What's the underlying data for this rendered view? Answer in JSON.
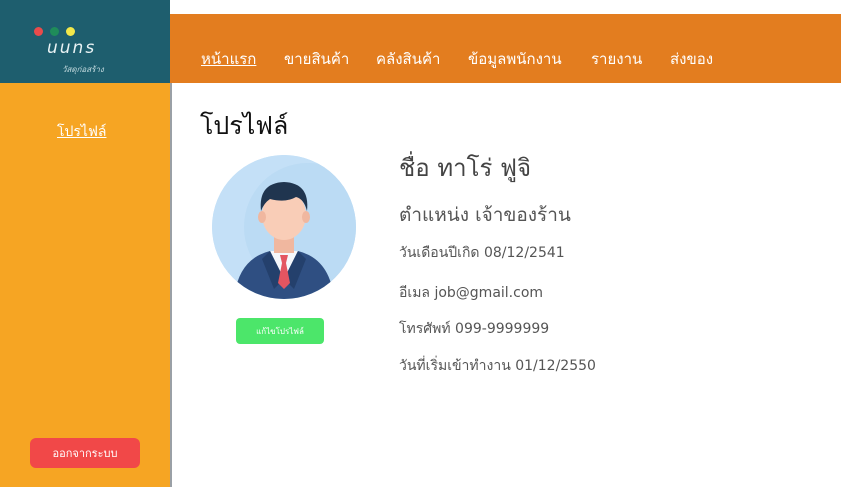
{
  "brand": {
    "logo_text": "uuns",
    "tagline": "วัสดุก่อสร้าง",
    "window_dots": [
      "#e94b4b",
      "#1f8c5a",
      "#f2e84a"
    ]
  },
  "nav": {
    "items": [
      {
        "label": "หน้าแรก",
        "active": true
      },
      {
        "label": "ขายสินค้า",
        "active": false
      },
      {
        "label": "คลังสินค้า",
        "active": false
      },
      {
        "label": "ข้อมูลพนักงาน",
        "active": false
      },
      {
        "label": "รายงาน",
        "active": false
      },
      {
        "label": "ส่งของ",
        "active": false
      }
    ]
  },
  "sidebar": {
    "profile_link": "โปรไฟล์",
    "logout_label": "ออกจากระบบ"
  },
  "profile": {
    "title": "โปรไฟล์",
    "name": "ชื่อ ทาโร่ ฟูจิ",
    "position": "ตำแหน่ง เจ้าของร้าน",
    "birthdate": "วันเดือนปีเกิด 08/12/2541",
    "email": "อีเมล job@gmail.com",
    "phone": "โทรศัพท์ 099-9999999",
    "start_date": "วันที่เริ่มเข้าทำงาน 01/12/2550",
    "edit_button": "แก้ไขโปรไฟล์"
  },
  "colors": {
    "brand_bg": "#1e5e6e",
    "nav_bg": "#e37d1f",
    "sidebar_bg": "#f6a523",
    "logout_bg": "#f14848",
    "edit_bg": "#4ce66a"
  }
}
